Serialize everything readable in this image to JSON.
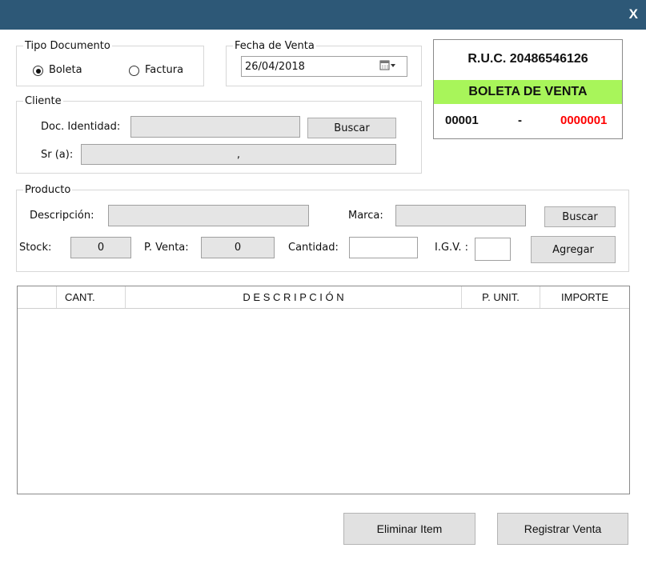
{
  "window": {
    "close_label": "X"
  },
  "tipo_documento": {
    "legend": "Tipo Documento",
    "options": [
      {
        "label": "Boleta",
        "checked": true
      },
      {
        "label": "Factura",
        "checked": false
      }
    ]
  },
  "fecha_venta": {
    "legend": "Fecha de Venta",
    "value": "26/04/2018"
  },
  "ruc_panel": {
    "ruc": "R.U.C. 20486546126",
    "doc_type": "BOLETA DE VENTA",
    "serie": "00001",
    "separator": "-",
    "numero": "0000001",
    "colors": {
      "banner": "#a8f55a",
      "numero": "#ff0000"
    }
  },
  "cliente": {
    "legend": "Cliente",
    "doc_label": "Doc. Identidad:",
    "doc_value": "",
    "buscar_label": "Buscar",
    "nombre_label": "Sr (a):",
    "nombre_value": ","
  },
  "producto": {
    "legend": "Producto",
    "descripcion_label": "Descripción:",
    "descripcion_value": "",
    "marca_label": "Marca:",
    "marca_value": "",
    "buscar_label": "Buscar",
    "stock_label": "Stock:",
    "stock_value": "0",
    "pventa_label": "P. Venta:",
    "pventa_value": "0",
    "cantidad_label": "Cantidad:",
    "cantidad_value": "",
    "igv_label": "I.G.V. :",
    "igv_value": "",
    "agregar_label": "Agregar"
  },
  "grid": {
    "columns": [
      "",
      "CANT.",
      "D E S C R I P C I Ó N",
      "P. UNIT.",
      "IMPORTE"
    ],
    "rows": []
  },
  "actions": {
    "eliminar_label": "Eliminar Item",
    "registrar_label": "Registrar Venta"
  }
}
